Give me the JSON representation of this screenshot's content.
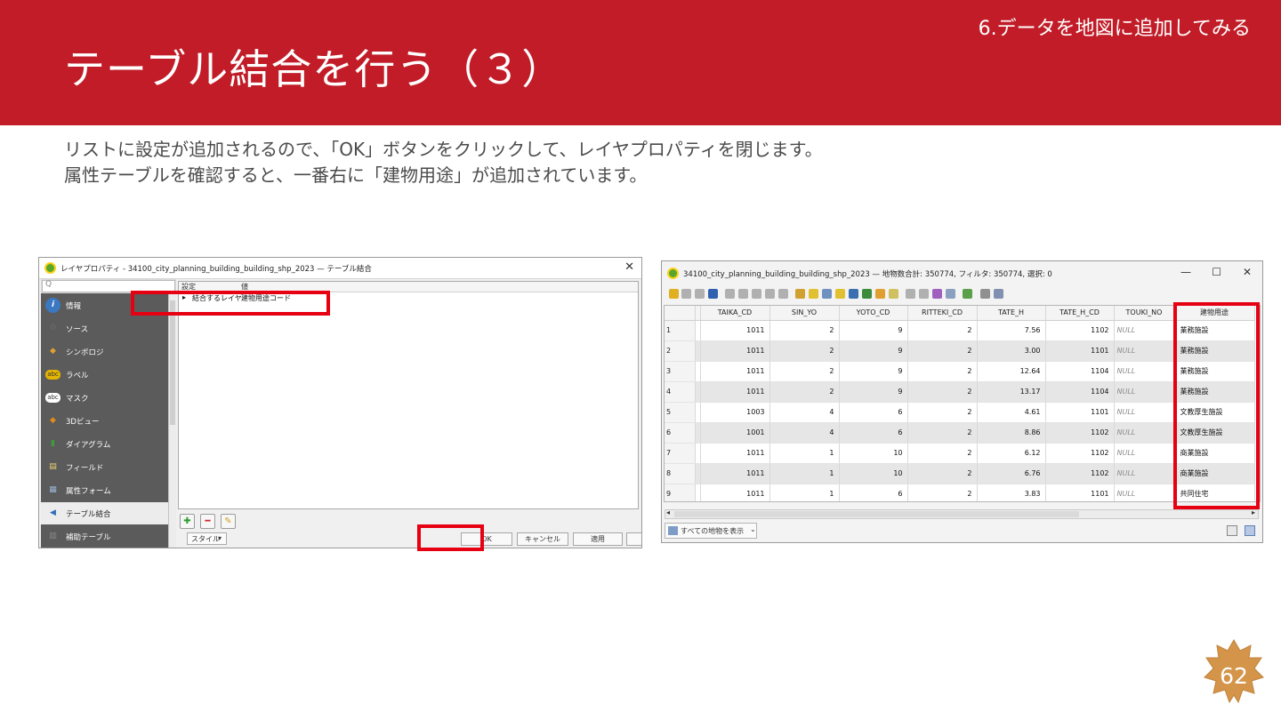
{
  "header": {
    "section_label": "6.データを地図に追加してみる",
    "title": "テーブル結合を行う（３）"
  },
  "description": {
    "line1": "リストに設定が追加されるので、「OK」ボタンをクリックして、レイヤプロパティを閉じます。",
    "line2": "属性テーブルを確認すると、一番右に「建物用途」が追加されています。"
  },
  "properties_dialog": {
    "title": "レイヤプロパティ - 34100_city_planning_building_building_shp_2023 — テーブル結合",
    "close": "✕",
    "search_icon_glyph": "Q",
    "nav_items": [
      {
        "label": "情報",
        "icon": "info-icon",
        "glyph": "i",
        "color": "#3a78c2"
      },
      {
        "label": "ソース",
        "icon": "source-icon",
        "glyph": "⚙",
        "color": "#6b6b6b"
      },
      {
        "label": "シンボロジ",
        "icon": "symbology-icon",
        "glyph": "◆",
        "color": "#e0a030"
      },
      {
        "label": "ラベル",
        "icon": "labels-icon",
        "glyph": "abc",
        "color": "#e4b400"
      },
      {
        "label": "マスク",
        "icon": "mask-icon",
        "glyph": "abc",
        "color": "#ffffff"
      },
      {
        "label": "3Dビュー",
        "icon": "3d-view-icon",
        "glyph": "◆",
        "color": "#e08c1a"
      },
      {
        "label": "ダイアグラム",
        "icon": "diagram-icon",
        "glyph": "▮",
        "color": "#3c9c3c"
      },
      {
        "label": "フィールド",
        "icon": "fields-icon",
        "glyph": "▤",
        "color": "#e8d070"
      },
      {
        "label": "属性フォーム",
        "icon": "attribute-form-icon",
        "glyph": "▦",
        "color": "#9ab4d6"
      },
      {
        "label": "テーブル結合",
        "icon": "joins-icon",
        "glyph": "◀",
        "color": "#2d6fb7"
      },
      {
        "label": "補助テーブル",
        "icon": "auxiliary-storage-icon",
        "glyph": "▥",
        "color": "#8a8a8a"
      }
    ],
    "tree_headers": {
      "setting": "設定",
      "value": "値"
    },
    "join_row": {
      "arrow": "▸",
      "label": "結合するレイヤ",
      "value": "建物用途コード"
    },
    "tools": {
      "add": "✚",
      "remove": "━",
      "edit": "✎"
    },
    "style_label": "スタイル",
    "style_arrow": "▾",
    "buttons": {
      "ok": "OK",
      "cancel": "キャンセル",
      "apply": "適用",
      "help": "ヘルプ"
    }
  },
  "attribute_table": {
    "title": "34100_city_planning_building_building_shp_2023 — 地物数合計: 350774, フィルタ: 350774, 選択: 0",
    "window_controls": {
      "minimize": "—",
      "maximize": "☐",
      "close": "✕"
    },
    "columns": [
      "",
      "",
      "TAIKA_CD",
      "SIN_YO",
      "YOTO_CD",
      "RITTEKI_CD",
      "TATE_H",
      "TATE_H_CD",
      "TOUKI_NO",
      "建物用途"
    ],
    "rows": [
      [
        "1",
        "",
        "1011",
        "2",
        "9",
        "2",
        "7.56",
        "1102",
        "NULL",
        "業務施設"
      ],
      [
        "2",
        "",
        "1011",
        "2",
        "9",
        "2",
        "3.00",
        "1101",
        "NULL",
        "業務施設"
      ],
      [
        "3",
        "",
        "1011",
        "2",
        "9",
        "2",
        "12.64",
        "1104",
        "NULL",
        "業務施設"
      ],
      [
        "4",
        "",
        "1011",
        "2",
        "9",
        "2",
        "13.17",
        "1104",
        "NULL",
        "業務施設"
      ],
      [
        "5",
        "",
        "1003",
        "4",
        "6",
        "2",
        "4.61",
        "1101",
        "NULL",
        "文教厚生施設"
      ],
      [
        "6",
        "",
        "1001",
        "4",
        "6",
        "2",
        "8.86",
        "1102",
        "NULL",
        "文教厚生施設"
      ],
      [
        "7",
        "",
        "1011",
        "1",
        "10",
        "2",
        "6.12",
        "1102",
        "NULL",
        "商業施設"
      ],
      [
        "8",
        "",
        "1011",
        "1",
        "10",
        "2",
        "6.76",
        "1102",
        "NULL",
        "商業施設"
      ],
      [
        "9",
        "",
        "1011",
        "1",
        "6",
        "2",
        "3.83",
        "1101",
        "NULL",
        "共同住宅"
      ]
    ],
    "show_all_label": "すべての地物を表示",
    "show_all_arrow": "⌄",
    "scroll_left": "◂",
    "scroll_right": "▸"
  },
  "colors": {
    "header_red": "#c11c27",
    "highlight_red": "#e60012",
    "badge": "#d4954a"
  },
  "page": {
    "number": "62"
  }
}
